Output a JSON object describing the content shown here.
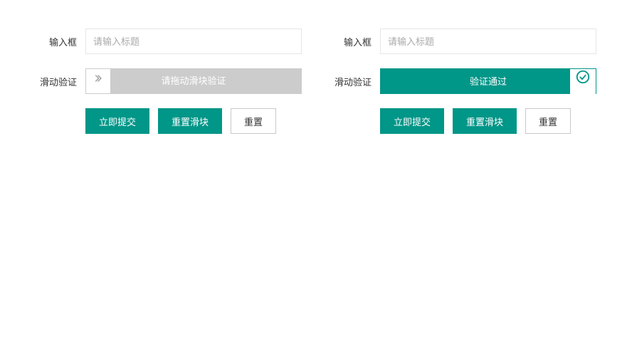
{
  "left": {
    "input_label": "输入框",
    "input_placeholder": "请输入标题",
    "slider_label": "滑动验证",
    "slider_text": "请拖动滑块验证",
    "submit_btn": "立即提交",
    "reset_slider_btn": "重置滑块",
    "reset_btn": "重置"
  },
  "right": {
    "input_label": "输入框",
    "input_placeholder": "请输入标题",
    "slider_label": "滑动验证",
    "slider_text": "验证通过",
    "submit_btn": "立即提交",
    "reset_slider_btn": "重置滑块",
    "reset_btn": "重置"
  },
  "colors": {
    "primary": "#009688",
    "slider_bg": "#cccccc"
  }
}
